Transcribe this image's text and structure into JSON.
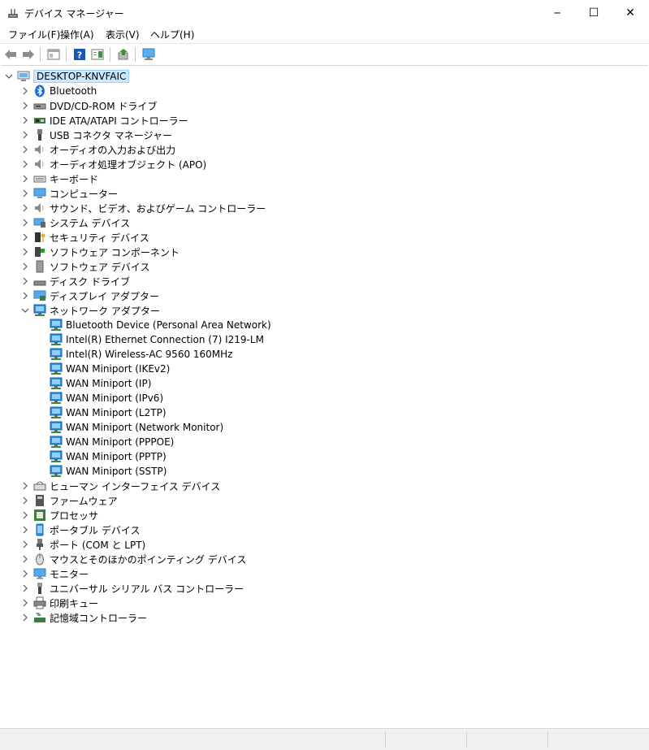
{
  "window": {
    "title": "デバイス マネージャー",
    "minimize_glyph": "─",
    "maximize_glyph": "☐",
    "close_glyph": "✕"
  },
  "menu": [
    "ファイル(F)",
    "操作(A)",
    "表示(V)",
    "ヘルプ(H)"
  ],
  "toolbar": [
    "back-arrow-icon",
    "forward-arrow-icon",
    "properties-icon",
    "help-icon",
    "action-pane-icon",
    "update-driver-icon",
    "scan-hardware-icon"
  ],
  "tree": {
    "root": "DESKTOP-KNVFAIC",
    "categories": [
      {
        "label": "Bluetooth",
        "icon": "bluetooth-icon",
        "expanded": false
      },
      {
        "label": "DVD/CD-ROM ドライブ",
        "icon": "dvd-drive-icon",
        "expanded": false
      },
      {
        "label": "IDE ATA/ATAPI コントローラー",
        "icon": "ide-controller-icon",
        "expanded": false
      },
      {
        "label": "USB コネクタ マネージャー",
        "icon": "usb-connector-icon",
        "expanded": false
      },
      {
        "label": "オーディオの入力および出力",
        "icon": "speaker-icon",
        "expanded": false
      },
      {
        "label": "オーディオ処理オブジェクト (APO)",
        "icon": "speaker-icon",
        "expanded": false
      },
      {
        "label": "キーボード",
        "icon": "keyboard-icon",
        "expanded": false
      },
      {
        "label": "コンピューター",
        "icon": "computer-icon",
        "expanded": false
      },
      {
        "label": "サウンド、ビデオ、およびゲーム コントローラー",
        "icon": "speaker-icon",
        "expanded": false
      },
      {
        "label": "システム デバイス",
        "icon": "system-device-icon",
        "expanded": false
      },
      {
        "label": "セキュリティ デバイス",
        "icon": "security-key-icon",
        "expanded": false
      },
      {
        "label": "ソフトウェア コンポーネント",
        "icon": "software-component-icon",
        "expanded": false
      },
      {
        "label": "ソフトウェア デバイス",
        "icon": "software-device-icon",
        "expanded": false
      },
      {
        "label": "ディスク ドライブ",
        "icon": "disk-drive-icon",
        "expanded": false
      },
      {
        "label": "ディスプレイ アダプター",
        "icon": "display-adapter-icon",
        "expanded": false
      },
      {
        "label": "ネットワーク アダプター",
        "icon": "network-adapter-icon",
        "expanded": true,
        "children": [
          "Bluetooth Device (Personal Area Network)",
          "Intel(R) Ethernet Connection (7) I219-LM",
          "Intel(R) Wireless-AC 9560 160MHz",
          "WAN Miniport (IKEv2)",
          "WAN Miniport (IP)",
          "WAN Miniport (IPv6)",
          "WAN Miniport (L2TP)",
          "WAN Miniport (Network Monitor)",
          "WAN Miniport (PPPOE)",
          "WAN Miniport (PPTP)",
          "WAN Miniport (SSTP)"
        ]
      },
      {
        "label": "ヒューマン インターフェイス デバイス",
        "icon": "hid-icon",
        "expanded": false
      },
      {
        "label": "ファームウェア",
        "icon": "firmware-icon",
        "expanded": false
      },
      {
        "label": "プロセッサ",
        "icon": "processor-icon",
        "expanded": false
      },
      {
        "label": "ポータブル デバイス",
        "icon": "portable-device-icon",
        "expanded": false
      },
      {
        "label": "ポート (COM と LPT)",
        "icon": "port-icon",
        "expanded": false
      },
      {
        "label": "マウスとそのほかのポインティング デバイス",
        "icon": "mouse-icon",
        "expanded": false
      },
      {
        "label": "モニター",
        "icon": "monitor-icon",
        "expanded": false
      },
      {
        "label": "ユニバーサル シリアル バス コントローラー",
        "icon": "usb-icon",
        "expanded": false
      },
      {
        "label": "印刷キュー",
        "icon": "printer-icon",
        "expanded": false
      },
      {
        "label": "記憶域コントローラー",
        "icon": "storage-controller-icon",
        "expanded": false
      }
    ]
  },
  "colors": {
    "selection_bg": "#cce8ff",
    "selection_border": "#99d1ff",
    "network_blue": "#2f8fd8"
  }
}
